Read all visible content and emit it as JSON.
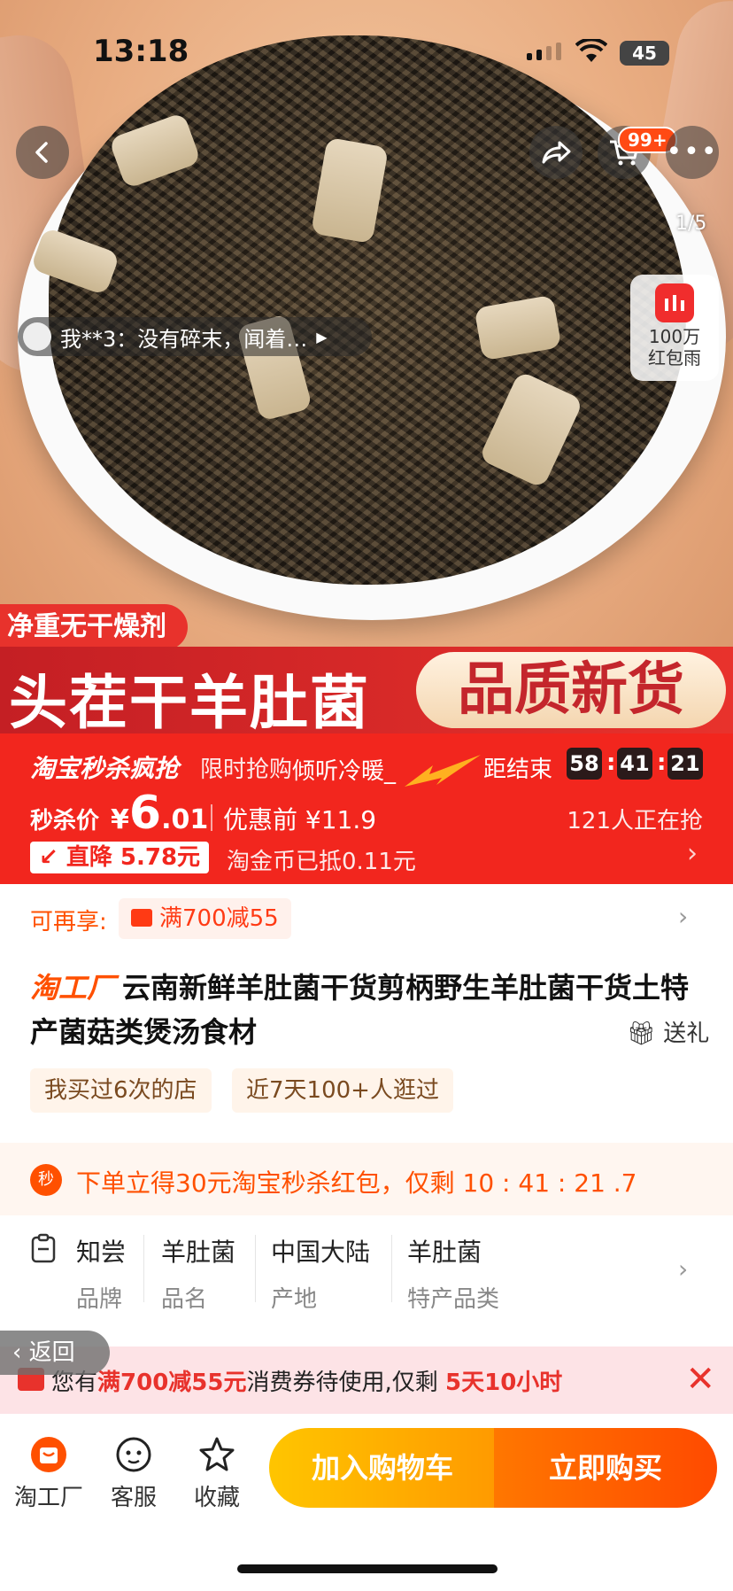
{
  "status_bar": {
    "time": "13:18",
    "battery": "45"
  },
  "hero": {
    "cart_badge": "99+",
    "image_counter": "1/5",
    "red_rain_label": "100万\n红包雨",
    "red_rain_l1": "100万",
    "red_rain_l2": "红包雨",
    "review_snippet": "我**3：没有碎末，闻着…",
    "banner_tag": "净重无干燥剂",
    "banner_main": "头茬干羊肚菌",
    "banner_pill": "品质新货"
  },
  "flash_sale": {
    "brand": "淘宝秒杀疯抢",
    "limited": "限时抢购",
    "overlay_text": "倾听冷暖_",
    "ends_label": "距结束",
    "countdown": {
      "h": "58",
      "m": "41",
      "s": "21"
    },
    "price_label": "秒杀价",
    "currency": "¥",
    "price_int": "6",
    "price_dec": ".01",
    "before_label": "优惠前 ¥11.9",
    "grabbing": "121人正在抢",
    "drop_label": "直降 5.78元",
    "coin_text": "淘金币已抵0.11元"
  },
  "coupon_row": {
    "label": "可再享:",
    "coupon": "满700减55"
  },
  "product": {
    "factory": "淘工厂",
    "title": "云南新鲜羊肚菌干货剪柄野生羊肚菌干货土特产菌菇类煲汤食材",
    "gift": "送礼",
    "chips": [
      "我买过6次的店",
      "近7天100+人逛过"
    ]
  },
  "alert": {
    "text": "下单立得30元淘宝秒杀红包，仅剩 10 : 41 : 21 .7",
    "icon": "秒"
  },
  "attributes": [
    {
      "value": "知尝",
      "key": "品牌"
    },
    {
      "value": "羊肚菌",
      "key": "品名"
    },
    {
      "value": "中国大陆",
      "key": "产地"
    },
    {
      "value": "羊肚菌",
      "key": "特产品类"
    }
  ],
  "back_float": "返回",
  "voucher_bar": {
    "pre": "您有",
    "amount": "满700减55元",
    "mid": "消费券待使用,仅剩",
    "remain": "5天10小时"
  },
  "bottom_bar": {
    "tabs": [
      {
        "label": "淘工厂",
        "icon": "factory-icon"
      },
      {
        "label": "客服",
        "icon": "service-icon"
      },
      {
        "label": "收藏",
        "icon": "star-icon"
      }
    ],
    "add_to_cart": "加入购物车",
    "buy_now": "立即购买"
  },
  "colors": {
    "accent": "#ff5000",
    "flash_red": "#f2261e",
    "cart_yellow": "#ffc500"
  }
}
